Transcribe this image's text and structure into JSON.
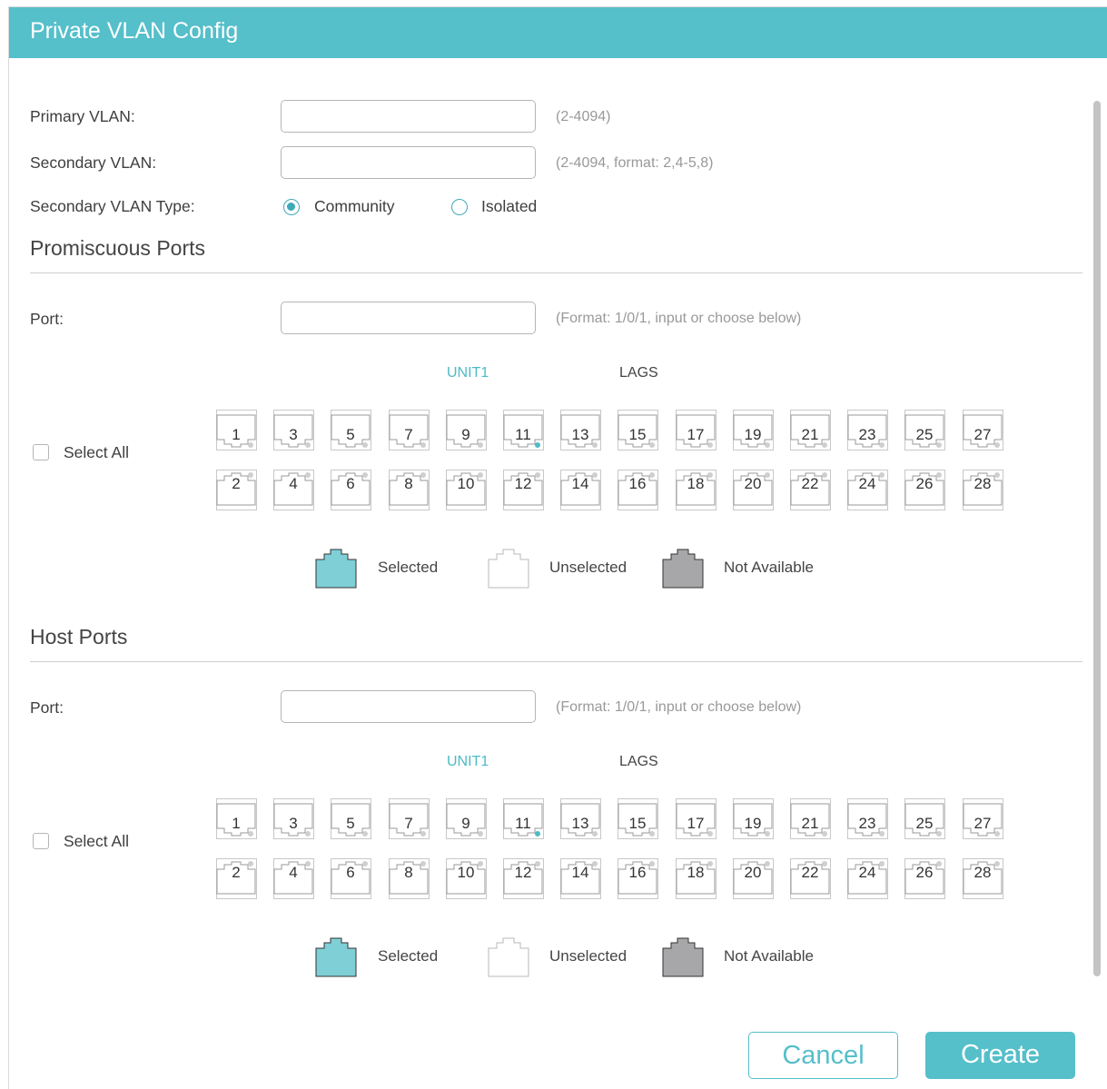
{
  "title": "Private VLAN Config",
  "form": {
    "primary_vlan": {
      "label": "Primary VLAN:",
      "value": "",
      "hint": "(2-4094)"
    },
    "secondary_vlan": {
      "label": "Secondary VLAN:",
      "value": "",
      "hint": "(2-4094, format: 2,4-5,8)"
    },
    "secondary_vlan_type": {
      "label": "Secondary VLAN Type:",
      "options": [
        "Community",
        "Isolated"
      ],
      "selected": "Community"
    }
  },
  "promiscuous": {
    "section_title": "Promiscuous Ports",
    "port_label": "Port:",
    "port_value": "",
    "port_hint": "(Format: 1/0/1, input or choose below)",
    "unit_label": "UNIT1",
    "lags_label": "LAGS",
    "select_all_label": "Select All",
    "ports_top": [
      "1",
      "3",
      "5",
      "7",
      "9",
      "11",
      "13",
      "15",
      "17",
      "19",
      "21",
      "23",
      "25",
      "27"
    ],
    "ports_bottom": [
      "2",
      "4",
      "6",
      "8",
      "10",
      "12",
      "14",
      "16",
      "18",
      "20",
      "22",
      "24",
      "26",
      "28"
    ]
  },
  "host": {
    "section_title": "Host Ports",
    "port_label": "Port:",
    "port_value": "",
    "port_hint": "(Format: 1/0/1, input or choose below)",
    "unit_label": "UNIT1",
    "lags_label": "LAGS",
    "select_all_label": "Select All",
    "ports_top": [
      "1",
      "3",
      "5",
      "7",
      "9",
      "11",
      "13",
      "15",
      "17",
      "19",
      "21",
      "23",
      "25",
      "27"
    ],
    "ports_bottom": [
      "2",
      "4",
      "6",
      "8",
      "10",
      "12",
      "14",
      "16",
      "18",
      "20",
      "22",
      "24",
      "26",
      "28"
    ]
  },
  "legend": {
    "selected": "Selected",
    "unselected": "Unselected",
    "not_available": "Not Available"
  },
  "buttons": {
    "cancel": "Cancel",
    "create": "Create"
  },
  "colors": {
    "accent": "#55bfca",
    "selected_fill": "#7fcfd6",
    "not_available_fill": "#a7a7a9"
  }
}
